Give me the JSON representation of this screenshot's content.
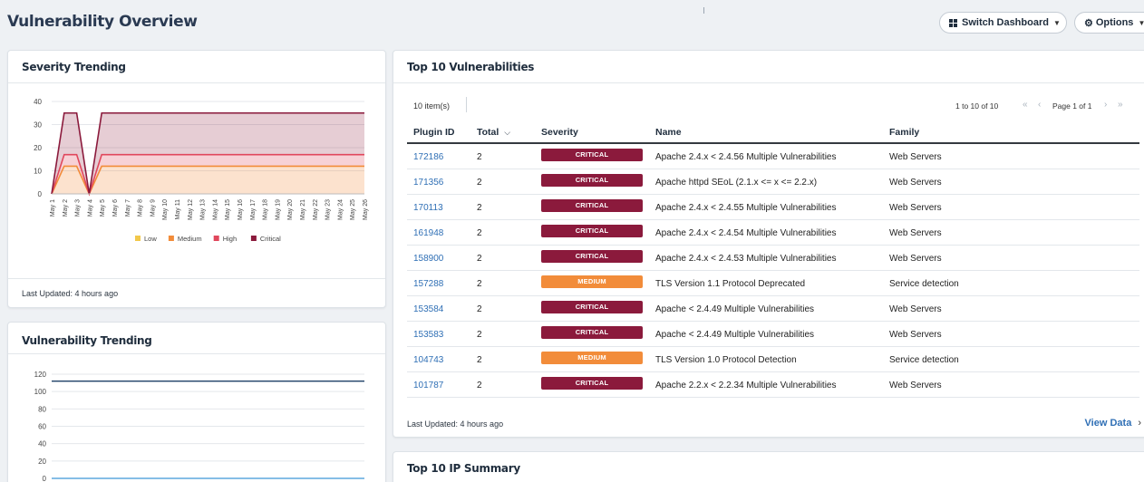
{
  "page": {
    "title": "Vulnerability Overview"
  },
  "header": {
    "switch_dashboard_label": "Switch Dashboard",
    "options_label": "Options",
    "grid_icon": "grid-icon",
    "gear_icon": "gear-icon"
  },
  "severity_card": {
    "title": "Severity Trending",
    "last_updated": "Last Updated: 4 hours ago"
  },
  "vuln_trending_card": {
    "title": "Vulnerability Trending"
  },
  "top10_card": {
    "title": "Top 10 Vulnerabilities",
    "item_count": "10 item(s)",
    "range_text": "1 to 10 of 10",
    "page_text": "Page 1 of 1",
    "columns": {
      "plugin_id": "Plugin ID",
      "total": "Total",
      "severity": "Severity",
      "name": "Name",
      "family": "Family"
    },
    "sort_indicator": "chevron-down-icon",
    "rows": [
      {
        "plugin_id": "172186",
        "total": "2",
        "severity": "CRITICAL",
        "name": "Apache 2.4.x < 2.4.56 Multiple Vulnerabilities",
        "family": "Web Servers"
      },
      {
        "plugin_id": "171356",
        "total": "2",
        "severity": "CRITICAL",
        "name": "Apache httpd SEoL (2.1.x <= x <= 2.2.x)",
        "family": "Web Servers"
      },
      {
        "plugin_id": "170113",
        "total": "2",
        "severity": "CRITICAL",
        "name": "Apache 2.4.x < 2.4.55 Multiple Vulnerabilities",
        "family": "Web Servers"
      },
      {
        "plugin_id": "161948",
        "total": "2",
        "severity": "CRITICAL",
        "name": "Apache 2.4.x < 2.4.54 Multiple Vulnerabilities",
        "family": "Web Servers"
      },
      {
        "plugin_id": "158900",
        "total": "2",
        "severity": "CRITICAL",
        "name": "Apache 2.4.x < 2.4.53 Multiple Vulnerabilities",
        "family": "Web Servers"
      },
      {
        "plugin_id": "157288",
        "total": "2",
        "severity": "MEDIUM",
        "name": "TLS Version 1.1 Protocol Deprecated",
        "family": "Service detection"
      },
      {
        "plugin_id": "153584",
        "total": "2",
        "severity": "CRITICAL",
        "name": "Apache < 2.4.49 Multiple Vulnerabilities",
        "family": "Web Servers"
      },
      {
        "plugin_id": "153583",
        "total": "2",
        "severity": "CRITICAL",
        "name": "Apache < 2.4.49 Multiple Vulnerabilities",
        "family": "Web Servers"
      },
      {
        "plugin_id": "104743",
        "total": "2",
        "severity": "MEDIUM",
        "name": "TLS Version 1.0 Protocol Detection",
        "family": "Service detection"
      },
      {
        "plugin_id": "101787",
        "total": "2",
        "severity": "CRITICAL",
        "name": "Apache 2.2.x < 2.2.34 Multiple Vulnerabilities",
        "family": "Web Servers"
      }
    ],
    "last_updated": "Last Updated: 4 hours ago",
    "view_data_label": "View Data"
  },
  "ip_card": {
    "title": "Top 10 IP Summary"
  },
  "colors": {
    "critical": "#8b1a3c",
    "medium": "#f28c3a",
    "low": "#f2c84b",
    "high": "#e0475c",
    "link": "#2f6fb5",
    "trend_line": "#1e3f66",
    "trend_low_line": "#5ea8dd"
  },
  "chart_data": [
    {
      "type": "area",
      "title": "Severity Trending",
      "x": [
        "May 1",
        "May 2",
        "May 3",
        "May 4",
        "May 5",
        "May 6",
        "May 7",
        "May 8",
        "May 9",
        "May 10",
        "May 11",
        "May 12",
        "May 13",
        "May 14",
        "May 15",
        "May 16",
        "May 17",
        "May 18",
        "May 19",
        "May 20",
        "May 21",
        "May 22",
        "May 23",
        "May 24",
        "May 25",
        "May 26"
      ],
      "ylim": [
        0,
        40
      ],
      "yticks": [
        0,
        10,
        20,
        30,
        40
      ],
      "stacked": true,
      "grid": true,
      "legend": "bottom",
      "series": [
        {
          "name": "Low",
          "color": "#f2c84b",
          "values": [
            0,
            0,
            0,
            0,
            0,
            0,
            0,
            0,
            0,
            0,
            0,
            0,
            0,
            0,
            0,
            0,
            0,
            0,
            0,
            0,
            0,
            0,
            0,
            0,
            0,
            0
          ]
        },
        {
          "name": "Medium",
          "color": "#f28c3a",
          "values": [
            0,
            12,
            12,
            0,
            12,
            12,
            12,
            12,
            12,
            12,
            12,
            12,
            12,
            12,
            12,
            12,
            12,
            12,
            12,
            12,
            12,
            12,
            12,
            12,
            12,
            12
          ]
        },
        {
          "name": "High",
          "color": "#e0475c",
          "values": [
            0,
            5,
            5,
            0,
            5,
            5,
            5,
            5,
            5,
            5,
            5,
            5,
            5,
            5,
            5,
            5,
            5,
            5,
            5,
            5,
            5,
            5,
            5,
            5,
            5,
            5
          ]
        },
        {
          "name": "Critical",
          "color": "#8b1a3c",
          "values": [
            0,
            18,
            18,
            0,
            18,
            18,
            18,
            18,
            18,
            18,
            18,
            18,
            18,
            18,
            18,
            18,
            18,
            18,
            18,
            18,
            18,
            18,
            18,
            18,
            18,
            18
          ]
        }
      ]
    },
    {
      "type": "line",
      "title": "Vulnerability Trending",
      "ylim": [
        0,
        120
      ],
      "yticks": [
        0,
        20,
        40,
        60,
        80,
        100,
        120
      ],
      "grid": true,
      "series": [
        {
          "color": "#1e3f66",
          "values": [
            112,
            112,
            112,
            112,
            112,
            112,
            112,
            112,
            112,
            112,
            112,
            112,
            112,
            112,
            112,
            112,
            112,
            112,
            112,
            112,
            112,
            112,
            112,
            112,
            112,
            112
          ]
        },
        {
          "color": "#5ea8dd",
          "values": [
            0,
            0,
            0,
            0,
            0,
            0,
            0,
            0,
            0,
            0,
            0,
            0,
            0,
            0,
            0,
            0,
            0,
            0,
            0,
            0,
            0,
            0,
            0,
            0,
            0,
            0
          ]
        }
      ]
    }
  ]
}
